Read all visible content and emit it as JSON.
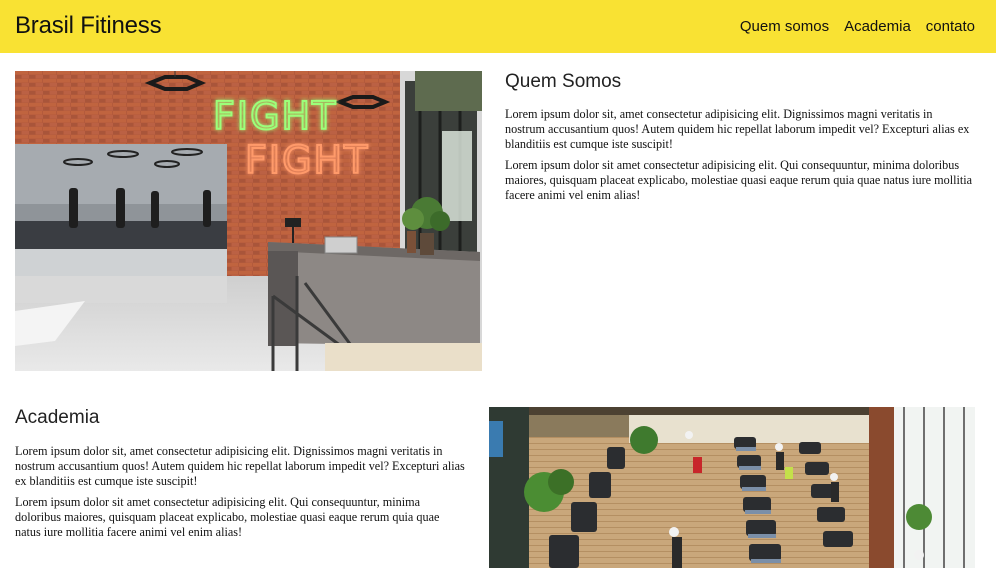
{
  "header": {
    "brand": "Brasil Fitiness",
    "nav": [
      "Quem somos",
      "Academia",
      "contato"
    ]
  },
  "quem_somos": {
    "title": "Quem Somos",
    "paragraphs": [
      "Lorem ipsum dolor sit, amet consectetur adipisicing elit. Dignissimos magni veritatis in nostrum accusantium quos! Autem quidem hic repellat laborum impedit vel? Excepturi alias ex blanditiis est cumque iste suscipit!",
      "Lorem ipsum dolor sit amet consectetur adipisicing elit. Qui consequuntur, minima doloribus maiores, quisquam placeat explicabo, molestiae quasi eaque rerum quia quae natus iure mollitia facere animi vel enim alias!"
    ],
    "image": {
      "neon_lines": [
        "FIGHT",
        "FIGHT"
      ]
    }
  },
  "academia": {
    "title": "Academia",
    "paragraphs": [
      "Lorem ipsum dolor sit, amet consectetur adipisicing elit. Dignissimos magni veritatis in nostrum accusantium quos! Autem quidem hic repellat laborum impedit vel? Excepturi alias ex blanditiis est cumque iste suscipit!",
      "Lorem ipsum dolor sit amet consectetur adipisicing elit. Qui consequuntur, minima doloribus maiores, quisquam placeat explicabo, molestiae quasi eaque rerum quia quae natus iure mollitia facere animi vel enim alias!"
    ]
  },
  "colors": {
    "header_bg": "#f9e233",
    "neon_green": "#9cff7a",
    "neon_orange": "#ff9a6a"
  }
}
